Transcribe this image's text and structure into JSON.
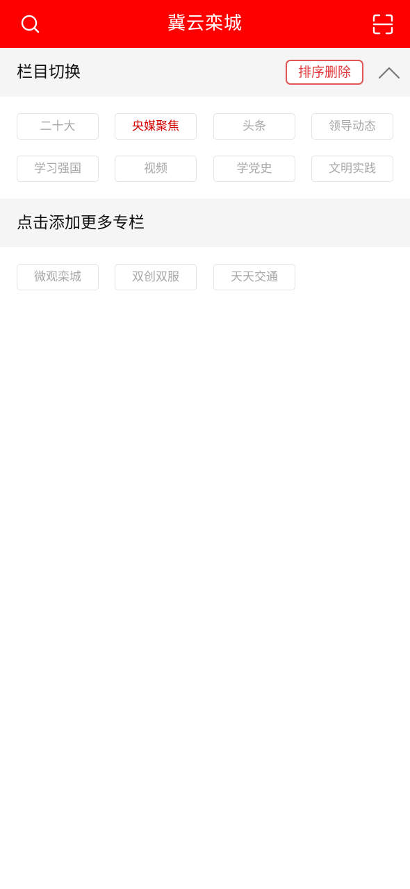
{
  "header": {
    "title": "冀云栾城",
    "search_icon": "search-icon",
    "scan_icon": "scan-icon",
    "background_color": "#ff0000"
  },
  "my_channels": {
    "label": "栏目切换",
    "sort_delete_label": "排序删除",
    "collapse_icon": "chevron-up-icon",
    "items": [
      {
        "label": "二十大",
        "active": false
      },
      {
        "label": "央媒聚焦",
        "active": true
      },
      {
        "label": "头条",
        "active": false
      },
      {
        "label": "领导动态",
        "active": false
      },
      {
        "label": "学习强国",
        "active": false
      },
      {
        "label": "视频",
        "active": false
      },
      {
        "label": "学党史",
        "active": false
      },
      {
        "label": "文明实践",
        "active": false
      }
    ]
  },
  "more_channels": {
    "label": "点击添加更多专栏",
    "items": [
      {
        "label": "微观栾城"
      },
      {
        "label": "双创双服"
      },
      {
        "label": "天天交通"
      }
    ]
  },
  "colors": {
    "accent": "#ff0000",
    "active_chip_text": "#d40000",
    "chip_text": "#a8a8a8",
    "sort_button_border": "#e05555"
  }
}
